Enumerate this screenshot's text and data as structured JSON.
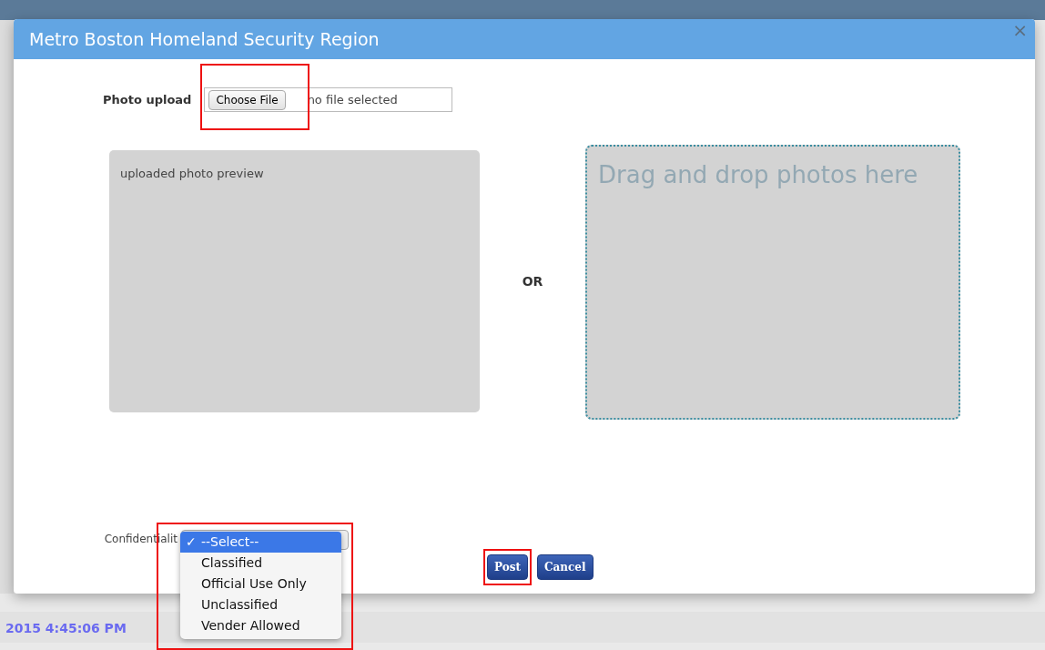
{
  "background": {
    "timestamp": "2015 4:45:06 PM"
  },
  "dialog": {
    "title": "Metro Boston Homeland Security Region",
    "close": "×"
  },
  "photo_upload": {
    "label": "Photo upload",
    "button": "Choose File",
    "status": "no file selected"
  },
  "preview": {
    "text": "uploaded photo preview"
  },
  "separator": "OR",
  "drop_zone": {
    "text": "Drag and drop photos here"
  },
  "confidentiality": {
    "label": "Confidentialit",
    "expanded": true,
    "check_mark": "✓",
    "options": [
      {
        "label": "--Select--",
        "selected": true
      },
      {
        "label": "Classified",
        "selected": false
      },
      {
        "label": "Official Use Only",
        "selected": false
      },
      {
        "label": "Unclassified",
        "selected": false
      },
      {
        "label": "Vender Allowed",
        "selected": false
      }
    ]
  },
  "buttons": [
    {
      "label": "Post"
    },
    {
      "label": "Cancel"
    }
  ]
}
